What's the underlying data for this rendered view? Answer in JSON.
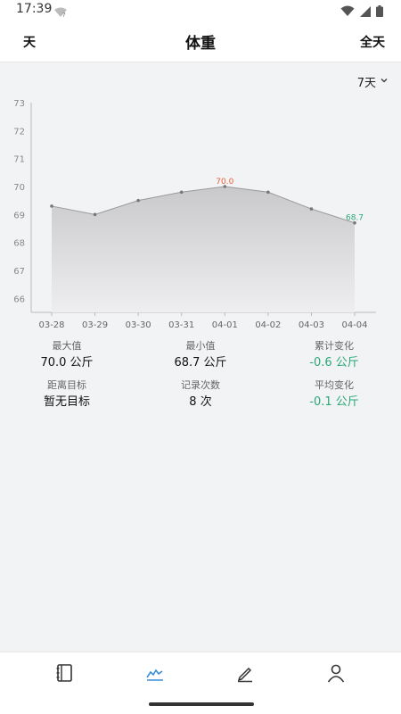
{
  "status_bar": {
    "time": "17:39",
    "icons": [
      "wifi-question-icon",
      "wifi-icon",
      "signal-icon",
      "battery-icon"
    ]
  },
  "header": {
    "left_label": "天",
    "title": "体重",
    "right_label": "全天"
  },
  "range_selector": {
    "selected": "7天",
    "icon": "chevron-down-icon"
  },
  "chart_data": {
    "type": "area",
    "categories": [
      "03-28",
      "03-29",
      "03-30",
      "03-31",
      "04-01",
      "04-02",
      "04-03",
      "04-04"
    ],
    "values": [
      69.3,
      69.0,
      69.5,
      69.8,
      70.0,
      69.8,
      69.2,
      68.7
    ],
    "y_ticks": [
      66,
      67,
      68,
      69,
      70,
      71,
      72,
      73
    ],
    "ylim": [
      65.5,
      73
    ],
    "max_label": "70.0",
    "min_label": "68.7",
    "line_color": "#999999",
    "max_label_color": "#e8603c",
    "min_label_color": "#2aa876",
    "grid": false
  },
  "stats": [
    [
      {
        "label": "最大值",
        "value": "70.0 公斤",
        "accent": false
      },
      {
        "label": "最小值",
        "value": "68.7 公斤",
        "accent": false
      },
      {
        "label": "累计变化",
        "value": "-0.6 公斤",
        "accent": true
      }
    ],
    [
      {
        "label": "距离目标",
        "value": "暂无目标",
        "accent": false
      },
      {
        "label": "记录次数",
        "value": "8 次",
        "accent": false
      },
      {
        "label": "平均变化",
        "value": "-0.1 公斤",
        "accent": true
      }
    ]
  ],
  "colors": {
    "accent_green": "#2aa876",
    "accent_orange": "#e8603c",
    "nav_active": "#3a8fd8"
  },
  "bottom_nav": [
    {
      "name": "journal",
      "icon": "notebook-icon",
      "active": false
    },
    {
      "name": "chart",
      "icon": "chart-icon",
      "active": true
    },
    {
      "name": "edit",
      "icon": "pencil-icon",
      "active": false
    },
    {
      "name": "profile",
      "icon": "user-icon",
      "active": false
    }
  ]
}
